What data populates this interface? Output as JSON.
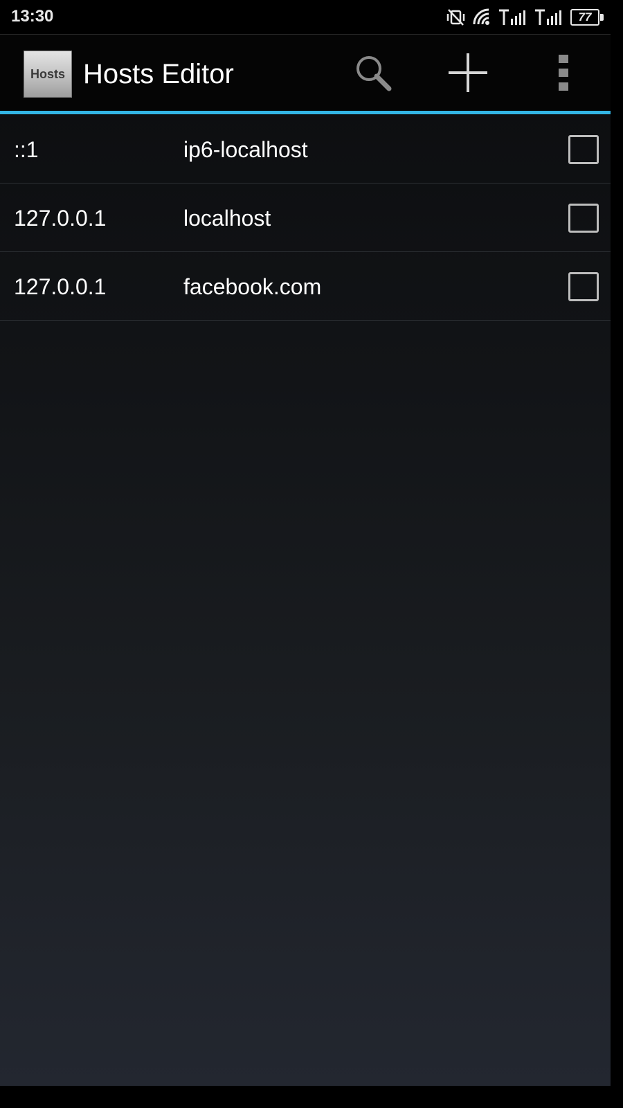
{
  "status_bar": {
    "time": "13:30",
    "battery_level": "77",
    "icons": [
      "vibrate-off-icon",
      "wifi-icon",
      "signal-icon",
      "signal-icon",
      "battery-icon"
    ]
  },
  "action_bar": {
    "logo_text": "Hosts",
    "title": "Hosts Editor",
    "actions": [
      "search-icon",
      "add-icon",
      "overflow-menu-icon"
    ],
    "accent_color": "#33b5e5"
  },
  "hosts": [
    {
      "ip": "::1",
      "hostname": "ip6-localhost",
      "checked": false
    },
    {
      "ip": "127.0.0.1",
      "hostname": "localhost",
      "checked": false
    },
    {
      "ip": "127.0.0.1",
      "hostname": "facebook.com",
      "checked": false
    }
  ]
}
